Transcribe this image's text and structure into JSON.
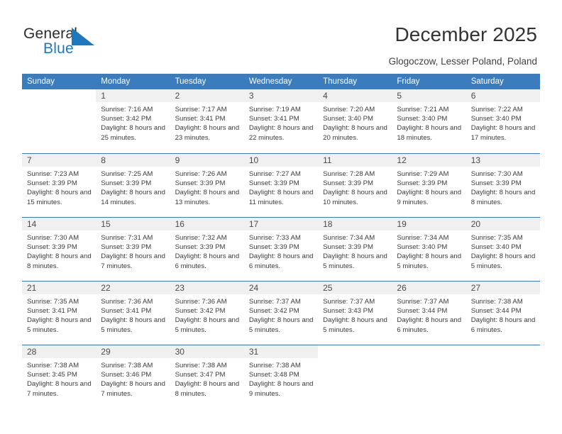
{
  "brand": {
    "name_part1": "General",
    "name_part2": "Blue",
    "logo_color": "#1c79c0"
  },
  "header": {
    "title": "December 2025",
    "subtitle": "Glogoczow, Lesser Poland, Poland"
  },
  "calendar": {
    "accent_color": "#3a7cbe",
    "weekdays": [
      "Sunday",
      "Monday",
      "Tuesday",
      "Wednesday",
      "Thursday",
      "Friday",
      "Saturday"
    ],
    "weeks": [
      [
        {
          "day": "",
          "sunrise": "",
          "sunset": "",
          "daylight": "",
          "empty": true
        },
        {
          "day": "1",
          "sunrise": "Sunrise: 7:16 AM",
          "sunset": "Sunset: 3:42 PM",
          "daylight": "Daylight: 8 hours and 25 minutes."
        },
        {
          "day": "2",
          "sunrise": "Sunrise: 7:17 AM",
          "sunset": "Sunset: 3:41 PM",
          "daylight": "Daylight: 8 hours and 23 minutes."
        },
        {
          "day": "3",
          "sunrise": "Sunrise: 7:19 AM",
          "sunset": "Sunset: 3:41 PM",
          "daylight": "Daylight: 8 hours and 22 minutes."
        },
        {
          "day": "4",
          "sunrise": "Sunrise: 7:20 AM",
          "sunset": "Sunset: 3:40 PM",
          "daylight": "Daylight: 8 hours and 20 minutes."
        },
        {
          "day": "5",
          "sunrise": "Sunrise: 7:21 AM",
          "sunset": "Sunset: 3:40 PM",
          "daylight": "Daylight: 8 hours and 18 minutes."
        },
        {
          "day": "6",
          "sunrise": "Sunrise: 7:22 AM",
          "sunset": "Sunset: 3:40 PM",
          "daylight": "Daylight: 8 hours and 17 minutes."
        }
      ],
      [
        {
          "day": "7",
          "sunrise": "Sunrise: 7:23 AM",
          "sunset": "Sunset: 3:39 PM",
          "daylight": "Daylight: 8 hours and 15 minutes."
        },
        {
          "day": "8",
          "sunrise": "Sunrise: 7:25 AM",
          "sunset": "Sunset: 3:39 PM",
          "daylight": "Daylight: 8 hours and 14 minutes."
        },
        {
          "day": "9",
          "sunrise": "Sunrise: 7:26 AM",
          "sunset": "Sunset: 3:39 PM",
          "daylight": "Daylight: 8 hours and 13 minutes."
        },
        {
          "day": "10",
          "sunrise": "Sunrise: 7:27 AM",
          "sunset": "Sunset: 3:39 PM",
          "daylight": "Daylight: 8 hours and 11 minutes."
        },
        {
          "day": "11",
          "sunrise": "Sunrise: 7:28 AM",
          "sunset": "Sunset: 3:39 PM",
          "daylight": "Daylight: 8 hours and 10 minutes."
        },
        {
          "day": "12",
          "sunrise": "Sunrise: 7:29 AM",
          "sunset": "Sunset: 3:39 PM",
          "daylight": "Daylight: 8 hours and 9 minutes."
        },
        {
          "day": "13",
          "sunrise": "Sunrise: 7:30 AM",
          "sunset": "Sunset: 3:39 PM",
          "daylight": "Daylight: 8 hours and 8 minutes."
        }
      ],
      [
        {
          "day": "14",
          "sunrise": "Sunrise: 7:30 AM",
          "sunset": "Sunset: 3:39 PM",
          "daylight": "Daylight: 8 hours and 8 minutes."
        },
        {
          "day": "15",
          "sunrise": "Sunrise: 7:31 AM",
          "sunset": "Sunset: 3:39 PM",
          "daylight": "Daylight: 8 hours and 7 minutes."
        },
        {
          "day": "16",
          "sunrise": "Sunrise: 7:32 AM",
          "sunset": "Sunset: 3:39 PM",
          "daylight": "Daylight: 8 hours and 6 minutes."
        },
        {
          "day": "17",
          "sunrise": "Sunrise: 7:33 AM",
          "sunset": "Sunset: 3:39 PM",
          "daylight": "Daylight: 8 hours and 6 minutes."
        },
        {
          "day": "18",
          "sunrise": "Sunrise: 7:34 AM",
          "sunset": "Sunset: 3:39 PM",
          "daylight": "Daylight: 8 hours and 5 minutes."
        },
        {
          "day": "19",
          "sunrise": "Sunrise: 7:34 AM",
          "sunset": "Sunset: 3:40 PM",
          "daylight": "Daylight: 8 hours and 5 minutes."
        },
        {
          "day": "20",
          "sunrise": "Sunrise: 7:35 AM",
          "sunset": "Sunset: 3:40 PM",
          "daylight": "Daylight: 8 hours and 5 minutes."
        }
      ],
      [
        {
          "day": "21",
          "sunrise": "Sunrise: 7:35 AM",
          "sunset": "Sunset: 3:41 PM",
          "daylight": "Daylight: 8 hours and 5 minutes."
        },
        {
          "day": "22",
          "sunrise": "Sunrise: 7:36 AM",
          "sunset": "Sunset: 3:41 PM",
          "daylight": "Daylight: 8 hours and 5 minutes."
        },
        {
          "day": "23",
          "sunrise": "Sunrise: 7:36 AM",
          "sunset": "Sunset: 3:42 PM",
          "daylight": "Daylight: 8 hours and 5 minutes."
        },
        {
          "day": "24",
          "sunrise": "Sunrise: 7:37 AM",
          "sunset": "Sunset: 3:42 PM",
          "daylight": "Daylight: 8 hours and 5 minutes."
        },
        {
          "day": "25",
          "sunrise": "Sunrise: 7:37 AM",
          "sunset": "Sunset: 3:43 PM",
          "daylight": "Daylight: 8 hours and 5 minutes."
        },
        {
          "day": "26",
          "sunrise": "Sunrise: 7:37 AM",
          "sunset": "Sunset: 3:44 PM",
          "daylight": "Daylight: 8 hours and 6 minutes."
        },
        {
          "day": "27",
          "sunrise": "Sunrise: 7:38 AM",
          "sunset": "Sunset: 3:44 PM",
          "daylight": "Daylight: 8 hours and 6 minutes."
        }
      ],
      [
        {
          "day": "28",
          "sunrise": "Sunrise: 7:38 AM",
          "sunset": "Sunset: 3:45 PM",
          "daylight": "Daylight: 8 hours and 7 minutes."
        },
        {
          "day": "29",
          "sunrise": "Sunrise: 7:38 AM",
          "sunset": "Sunset: 3:46 PM",
          "daylight": "Daylight: 8 hours and 7 minutes."
        },
        {
          "day": "30",
          "sunrise": "Sunrise: 7:38 AM",
          "sunset": "Sunset: 3:47 PM",
          "daylight": "Daylight: 8 hours and 8 minutes."
        },
        {
          "day": "31",
          "sunrise": "Sunrise: 7:38 AM",
          "sunset": "Sunset: 3:48 PM",
          "daylight": "Daylight: 8 hours and 9 minutes."
        },
        {
          "day": "",
          "sunrise": "",
          "sunset": "",
          "daylight": "",
          "empty": true
        },
        {
          "day": "",
          "sunrise": "",
          "sunset": "",
          "daylight": "",
          "empty": true
        },
        {
          "day": "",
          "sunrise": "",
          "sunset": "",
          "daylight": "",
          "empty": true
        }
      ]
    ]
  }
}
